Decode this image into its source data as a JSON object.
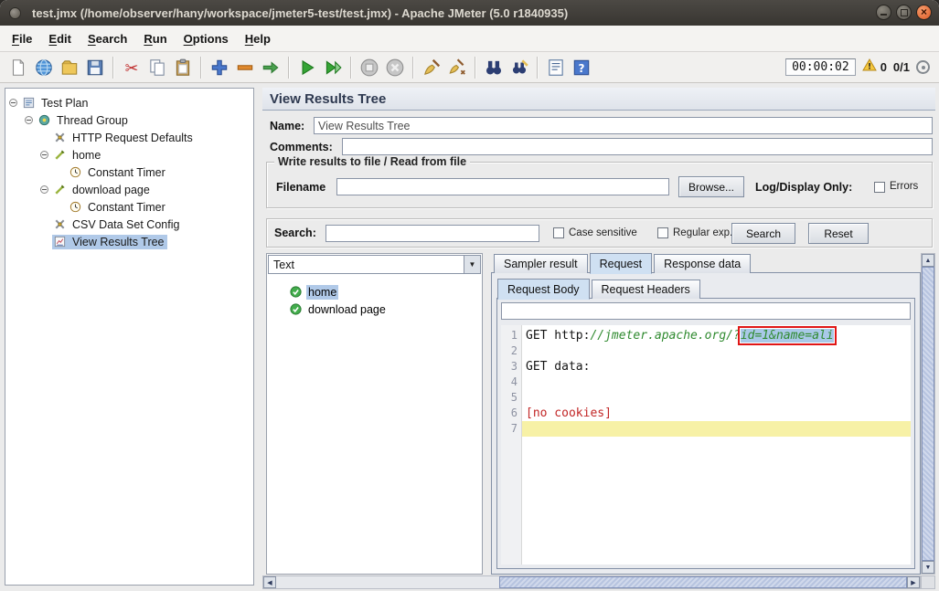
{
  "window": {
    "title": "test.jmx (/home/observer/hany/workspace/jmeter5-test/test.jmx) - Apache JMeter (5.0 r1840935)"
  },
  "menubar": {
    "items": [
      {
        "label": "File"
      },
      {
        "label": "Edit"
      },
      {
        "label": "Search"
      },
      {
        "label": "Run"
      },
      {
        "label": "Options"
      },
      {
        "label": "Help"
      }
    ]
  },
  "toolbar": {
    "timer": "00:00:02",
    "error_count": "0",
    "thread_count": "0/1",
    "icons": [
      {
        "name": "new-file-icon"
      },
      {
        "name": "open-file-icon"
      },
      {
        "name": "templates-icon"
      },
      {
        "name": "save-icon"
      },
      {
        "sep": true
      },
      {
        "name": "cut-icon"
      },
      {
        "name": "copy-icon"
      },
      {
        "name": "paste-icon"
      },
      {
        "sep": true
      },
      {
        "name": "add-element-icon"
      },
      {
        "name": "remove-element-icon"
      },
      {
        "name": "toggle-element-icon"
      },
      {
        "sep": true
      },
      {
        "name": "start-icon"
      },
      {
        "name": "start-no-pauses-icon"
      },
      {
        "sep": true
      },
      {
        "name": "stop-icon"
      },
      {
        "name": "shutdown-icon"
      },
      {
        "sep": true
      },
      {
        "name": "clear-icon"
      },
      {
        "name": "clear-all-icon"
      },
      {
        "sep": true
      },
      {
        "name": "search-icon"
      },
      {
        "name": "search-reset-icon"
      },
      {
        "sep": true
      },
      {
        "name": "function-helper-icon"
      },
      {
        "name": "help-icon"
      }
    ]
  },
  "tree": {
    "items": [
      {
        "label": "Test Plan",
        "level": 0,
        "icon": "test-plan",
        "expandable": true
      },
      {
        "label": "Thread Group",
        "level": 1,
        "icon": "thread-group",
        "expandable": true
      },
      {
        "label": "HTTP Request Defaults",
        "level": 2,
        "icon": "config"
      },
      {
        "label": "home",
        "level": 2,
        "icon": "sampler",
        "expandable": true
      },
      {
        "label": "Constant Timer",
        "level": 3,
        "icon": "timer"
      },
      {
        "label": "download page",
        "level": 2,
        "icon": "sampler",
        "expandable": true
      },
      {
        "label": "Constant Timer",
        "level": 3,
        "icon": "timer"
      },
      {
        "label": "CSV Data Set Config",
        "level": 2,
        "icon": "config"
      },
      {
        "label": "View Results Tree",
        "level": 2,
        "icon": "results",
        "selected": true
      }
    ]
  },
  "panel": {
    "title": "View Results Tree",
    "name_label": "Name:",
    "name_value": "View Results Tree",
    "comments_label": "Comments:",
    "comments_value": "",
    "file_section": {
      "title": "Write results to file / Read from file",
      "filename_label": "Filename",
      "filename_value": "",
      "browse_label": "Browse...",
      "log_display_label": "Log/Display Only:",
      "errors_label": "Errors"
    },
    "search": {
      "label": "Search:",
      "value": "",
      "case_label": "Case sensitive",
      "regex_label": "Regular exp.",
      "search_label": "Search",
      "reset_label": "Reset"
    },
    "results_panel": {
      "renderer": "Text",
      "items": [
        {
          "label": "home",
          "selected": true
        },
        {
          "label": "download page"
        }
      ]
    },
    "tabs": [
      {
        "label": "Sampler result"
      },
      {
        "label": "Request",
        "active": true
      },
      {
        "label": "Response data"
      }
    ],
    "request_tabs": [
      {
        "label": "Request Body",
        "active": true
      },
      {
        "label": "Request Headers"
      }
    ],
    "editor": {
      "lines": [
        {
          "num": "1",
          "segments": [
            {
              "text": "GET http:",
              "style": "plain"
            },
            {
              "text": "//jmeter.apache.org/?",
              "style": "comment"
            },
            {
              "text": "id=1&name=ali",
              "style": "selected"
            }
          ]
        },
        {
          "num": "2",
          "segments": []
        },
        {
          "num": "3",
          "segments": [
            {
              "text": "GET data:",
              "style": "plain"
            }
          ]
        },
        {
          "num": "4",
          "segments": []
        },
        {
          "num": "5",
          "segments": []
        },
        {
          "num": "6",
          "segments": [
            {
              "text": "[no cookies]",
              "style": "error"
            }
          ]
        },
        {
          "num": "7",
          "segments": [],
          "current": true
        }
      ]
    }
  }
}
